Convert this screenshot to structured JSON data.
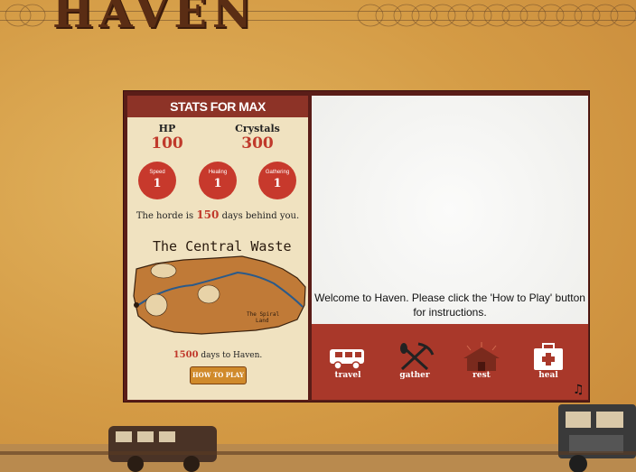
{
  "game": {
    "title": "HAVEN"
  },
  "stats": {
    "heading": "STATS FOR MAX",
    "hp_label": "HP",
    "hp_value": "100",
    "crystals_label": "Crystals",
    "crystals_value": "300",
    "skills": [
      {
        "label": "Speed",
        "value": "1"
      },
      {
        "label": "Healing",
        "value": "1"
      },
      {
        "label": "Gathering",
        "value": "1"
      }
    ],
    "horde_prefix": "The horde is",
    "horde_days": "150",
    "horde_suffix": "days behind you.",
    "map_title": "The Central Waste",
    "days_value": "1500",
    "days_suffix": "days to Haven.",
    "how_to_play": "HOW TO PLAY"
  },
  "screen": {
    "message": "Welcome to Haven. Please click the 'How to Play' button for instructions."
  },
  "actions": [
    {
      "label": "travel",
      "icon": "van-icon"
    },
    {
      "label": "gather",
      "icon": "pickaxe-shovel-icon"
    },
    {
      "label": "rest",
      "icon": "cabin-icon"
    },
    {
      "label": "heal",
      "icon": "first-aid-kit-icon"
    }
  ],
  "music_icon": "music-note-icon",
  "colors": {
    "accent_red": "#c0392b",
    "frame": "#5a1d18",
    "action_bar": "#a9382a",
    "panel": "#f0e2c0"
  }
}
